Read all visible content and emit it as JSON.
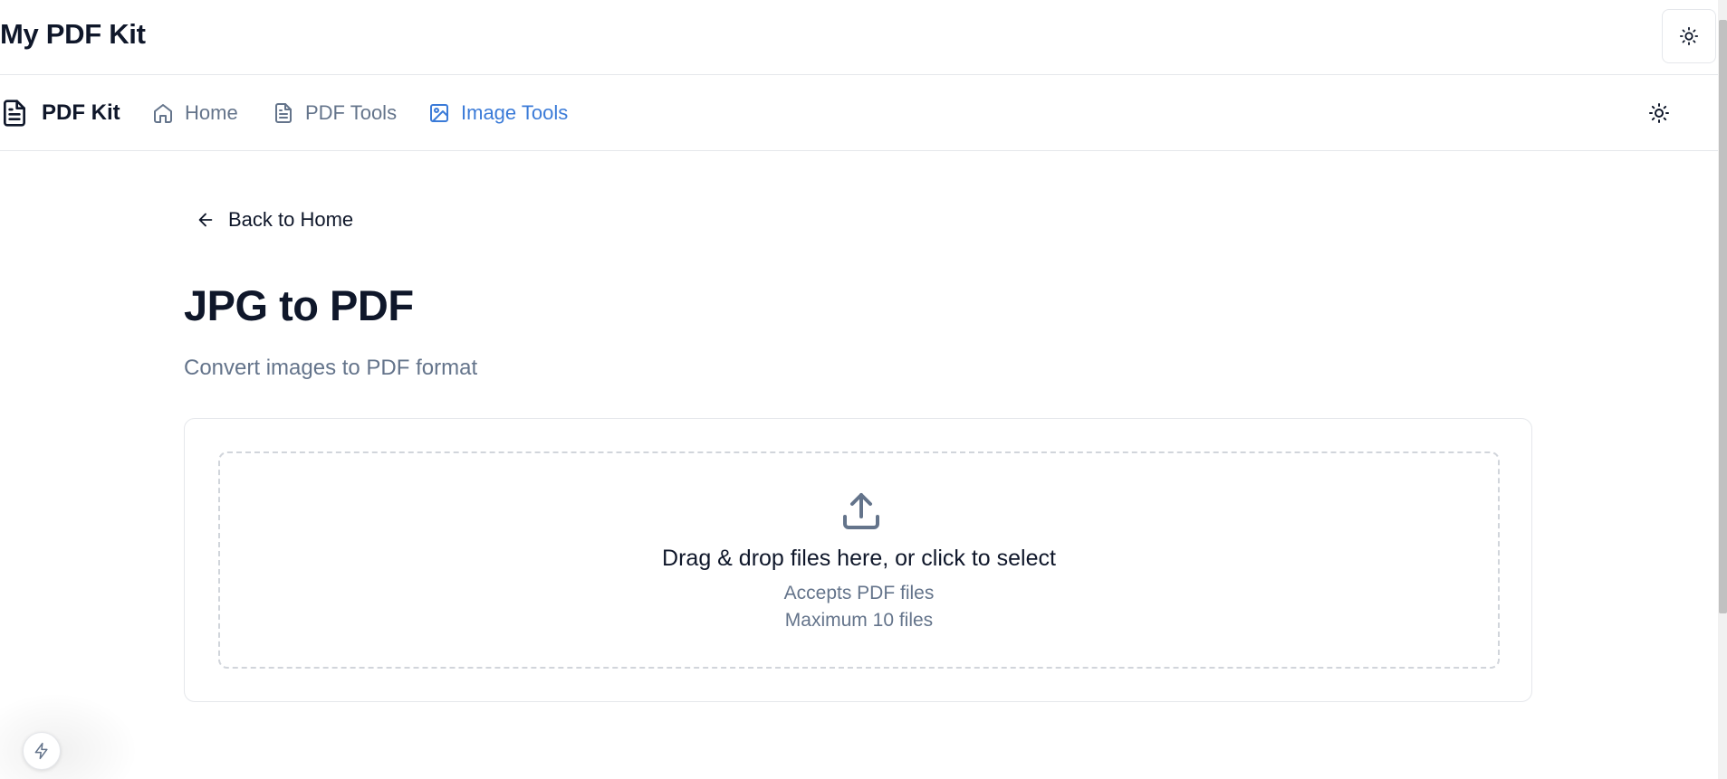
{
  "app": {
    "title": "My PDF Kit"
  },
  "nav": {
    "brand": "PDF Kit",
    "items": [
      {
        "label": "Home",
        "icon": "home-icon",
        "active": false
      },
      {
        "label": "PDF Tools",
        "icon": "file-text-icon",
        "active": false
      },
      {
        "label": "Image Tools",
        "icon": "image-icon",
        "active": true
      }
    ]
  },
  "back_link": {
    "label": "Back to Home",
    "icon": "arrow-left-icon"
  },
  "page": {
    "title": "JPG to PDF",
    "subtitle": "Convert images to PDF format"
  },
  "dropzone": {
    "icon": "upload-icon",
    "main_text": "Drag & drop files here, or click to select",
    "accepts_text": "Accepts PDF files",
    "limit_text": "Maximum 10 files"
  },
  "colors": {
    "accent": "#3b7bd8",
    "text_primary": "#0f172a",
    "text_muted": "#64748b",
    "border": "#e5e7eb"
  }
}
